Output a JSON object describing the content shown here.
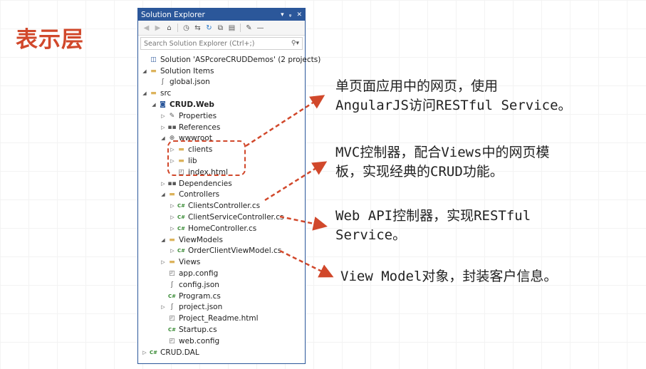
{
  "slide": {
    "title": "表示层"
  },
  "explorer": {
    "title": "Solution Explorer",
    "title_controls": [
      "▾",
      "ᵩ",
      "✕"
    ],
    "search_placeholder": "Search Solution Explorer (Ctrl+;)",
    "tree": [
      {
        "depth": 0,
        "arrow": "",
        "icon": "solution",
        "glyph": "◫",
        "label": "Solution 'ASPcoreCRUDDemos' (2 projects)",
        "bold": false
      },
      {
        "depth": 0,
        "arrow": "◢",
        "icon": "folder",
        "glyph": "▬",
        "label": "Solution Items",
        "bold": false
      },
      {
        "depth": 1,
        "arrow": "",
        "icon": "json",
        "glyph": "ʃ",
        "label": "global.json",
        "bold": false
      },
      {
        "depth": 0,
        "arrow": "◢",
        "icon": "folder",
        "glyph": "▬",
        "label": "src",
        "bold": false
      },
      {
        "depth": 1,
        "arrow": "◢",
        "icon": "project",
        "glyph": "◙",
        "label": "CRUD.Web",
        "bold": true
      },
      {
        "depth": 2,
        "arrow": "▷",
        "icon": "wrench",
        "glyph": "✎",
        "label": "Properties",
        "bold": false
      },
      {
        "depth": 2,
        "arrow": "▷",
        "icon": "references",
        "glyph": "▪▪",
        "label": "References",
        "bold": false
      },
      {
        "depth": 2,
        "arrow": "◢",
        "icon": "globe",
        "glyph": "⊕",
        "label": "wwwroot",
        "bold": false
      },
      {
        "depth": 3,
        "arrow": "▷",
        "icon": "folder",
        "glyph": "▬",
        "label": "clients",
        "bold": false
      },
      {
        "depth": 3,
        "arrow": "▷",
        "icon": "folder",
        "glyph": "▬",
        "label": "lib",
        "bold": false
      },
      {
        "depth": 3,
        "arrow": "",
        "icon": "html",
        "glyph": "◰",
        "label": "index.html",
        "bold": false
      },
      {
        "depth": 2,
        "arrow": "▷",
        "icon": "dependencies",
        "glyph": "▪▪",
        "label": "Dependencies",
        "bold": false
      },
      {
        "depth": 2,
        "arrow": "◢",
        "icon": "folder",
        "glyph": "▬",
        "label": "Controllers",
        "bold": false
      },
      {
        "depth": 3,
        "arrow": "▷",
        "icon": "cs",
        "glyph": "C#",
        "label": "ClientsController.cs",
        "bold": false
      },
      {
        "depth": 3,
        "arrow": "▷",
        "icon": "cs",
        "glyph": "C#",
        "label": "ClientServiceController.cs",
        "bold": false
      },
      {
        "depth": 3,
        "arrow": "▷",
        "icon": "cs",
        "glyph": "C#",
        "label": "HomeController.cs",
        "bold": false
      },
      {
        "depth": 2,
        "arrow": "◢",
        "icon": "folder",
        "glyph": "▬",
        "label": "ViewModels",
        "bold": false
      },
      {
        "depth": 3,
        "arrow": "▷",
        "icon": "cs",
        "glyph": "C#",
        "label": "OrderClientViewModel.cs",
        "bold": false
      },
      {
        "depth": 2,
        "arrow": "▷",
        "icon": "folder",
        "glyph": "▬",
        "label": "Views",
        "bold": false
      },
      {
        "depth": 2,
        "arrow": "",
        "icon": "config",
        "glyph": "◰",
        "label": "app.config",
        "bold": false
      },
      {
        "depth": 2,
        "arrow": "",
        "icon": "json",
        "glyph": "ʃ",
        "label": "config.json",
        "bold": false
      },
      {
        "depth": 2,
        "arrow": "",
        "icon": "cs",
        "glyph": "C#",
        "label": "Program.cs",
        "bold": false
      },
      {
        "depth": 2,
        "arrow": "▷",
        "icon": "json",
        "glyph": "ʃ",
        "label": "project.json",
        "bold": false
      },
      {
        "depth": 2,
        "arrow": "",
        "icon": "html",
        "glyph": "◰",
        "label": "Project_Readme.html",
        "bold": false
      },
      {
        "depth": 2,
        "arrow": "",
        "icon": "cs",
        "glyph": "C#",
        "label": "Startup.cs",
        "bold": false
      },
      {
        "depth": 2,
        "arrow": "",
        "icon": "config",
        "glyph": "◰",
        "label": "web.config",
        "bold": false
      },
      {
        "depth": 0,
        "arrow": "▷",
        "icon": "cs-project",
        "glyph": "C#",
        "label": "CRUD.DAL",
        "bold": false
      }
    ]
  },
  "annotations": {
    "n1_line1": "单页面应用中的网页，使用",
    "n1_line2": "AngularJS访问RESTful Service。",
    "n2_line1": "MVC控制器，配合Views中的网页模",
    "n2_line2": "板，实现经典的CRUD功能。",
    "n3_line1": "Web API控制器，实现RESTful",
    "n3_line2": "Service。",
    "n4_line1": "View Model对象，封装客户信息。"
  },
  "colors": {
    "accent": "#d1482b",
    "panel_border": "#2b579a"
  }
}
